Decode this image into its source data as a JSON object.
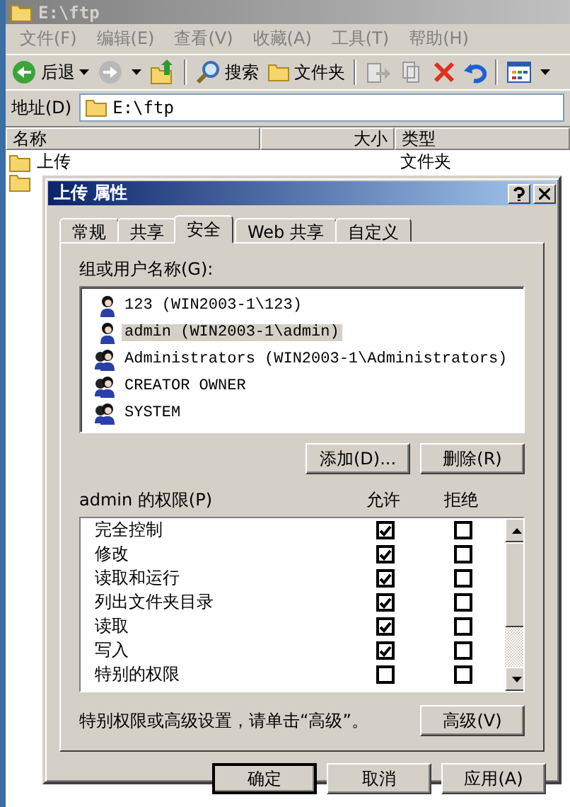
{
  "explorer": {
    "title": "E:\\ftp",
    "menu": [
      "文件(F)",
      "编辑(E)",
      "查看(V)",
      "收藏(A)",
      "工具(T)",
      "帮助(H)"
    ],
    "toolbar": {
      "back": "后退",
      "search": "搜索",
      "folders": "文件夹"
    },
    "address": {
      "label": "地址(D)",
      "value": "E:\\ftp"
    },
    "columns": [
      "名称",
      "大小",
      "类型"
    ],
    "rows": [
      {
        "name": "上传",
        "type": "文件夹"
      }
    ]
  },
  "dialog": {
    "title": "上传 属性",
    "tabs": [
      {
        "label": "常规",
        "selected": false
      },
      {
        "label": "共享",
        "selected": false
      },
      {
        "label": "安全",
        "selected": true
      },
      {
        "label": "Web 共享",
        "selected": false
      },
      {
        "label": "自定义",
        "selected": false
      }
    ],
    "users_label": "组或用户名称(G):",
    "users": [
      {
        "name": "123 (WIN2003-1\\123)",
        "kind": "user",
        "selected": false
      },
      {
        "name": "admin (WIN2003-1\\admin)",
        "kind": "user",
        "selected": true
      },
      {
        "name": "Administrators (WIN2003-1\\Administrators)",
        "kind": "group",
        "selected": false
      },
      {
        "name": "CREATOR OWNER",
        "kind": "group",
        "selected": false
      },
      {
        "name": "SYSTEM",
        "kind": "group",
        "selected": false
      }
    ],
    "add_button": "添加(D)...",
    "remove_button": "删除(R)",
    "permissions_label": "admin 的权限(P)",
    "allow_header": "允许",
    "deny_header": "拒绝",
    "permissions": [
      {
        "name": "完全控制",
        "allow": true,
        "deny": false
      },
      {
        "name": "修改",
        "allow": true,
        "deny": false
      },
      {
        "name": "读取和运行",
        "allow": true,
        "deny": false
      },
      {
        "name": "列出文件夹目录",
        "allow": true,
        "deny": false
      },
      {
        "name": "读取",
        "allow": true,
        "deny": false
      },
      {
        "name": "写入",
        "allow": true,
        "deny": false
      },
      {
        "name": "特别的权限",
        "allow": false,
        "deny": false
      }
    ],
    "advanced_hint": "特别权限或高级设置，请单击“高级”。",
    "advanced_button": "高级(V)",
    "buttons": [
      "确定",
      "取消",
      "应用(A)"
    ]
  }
}
